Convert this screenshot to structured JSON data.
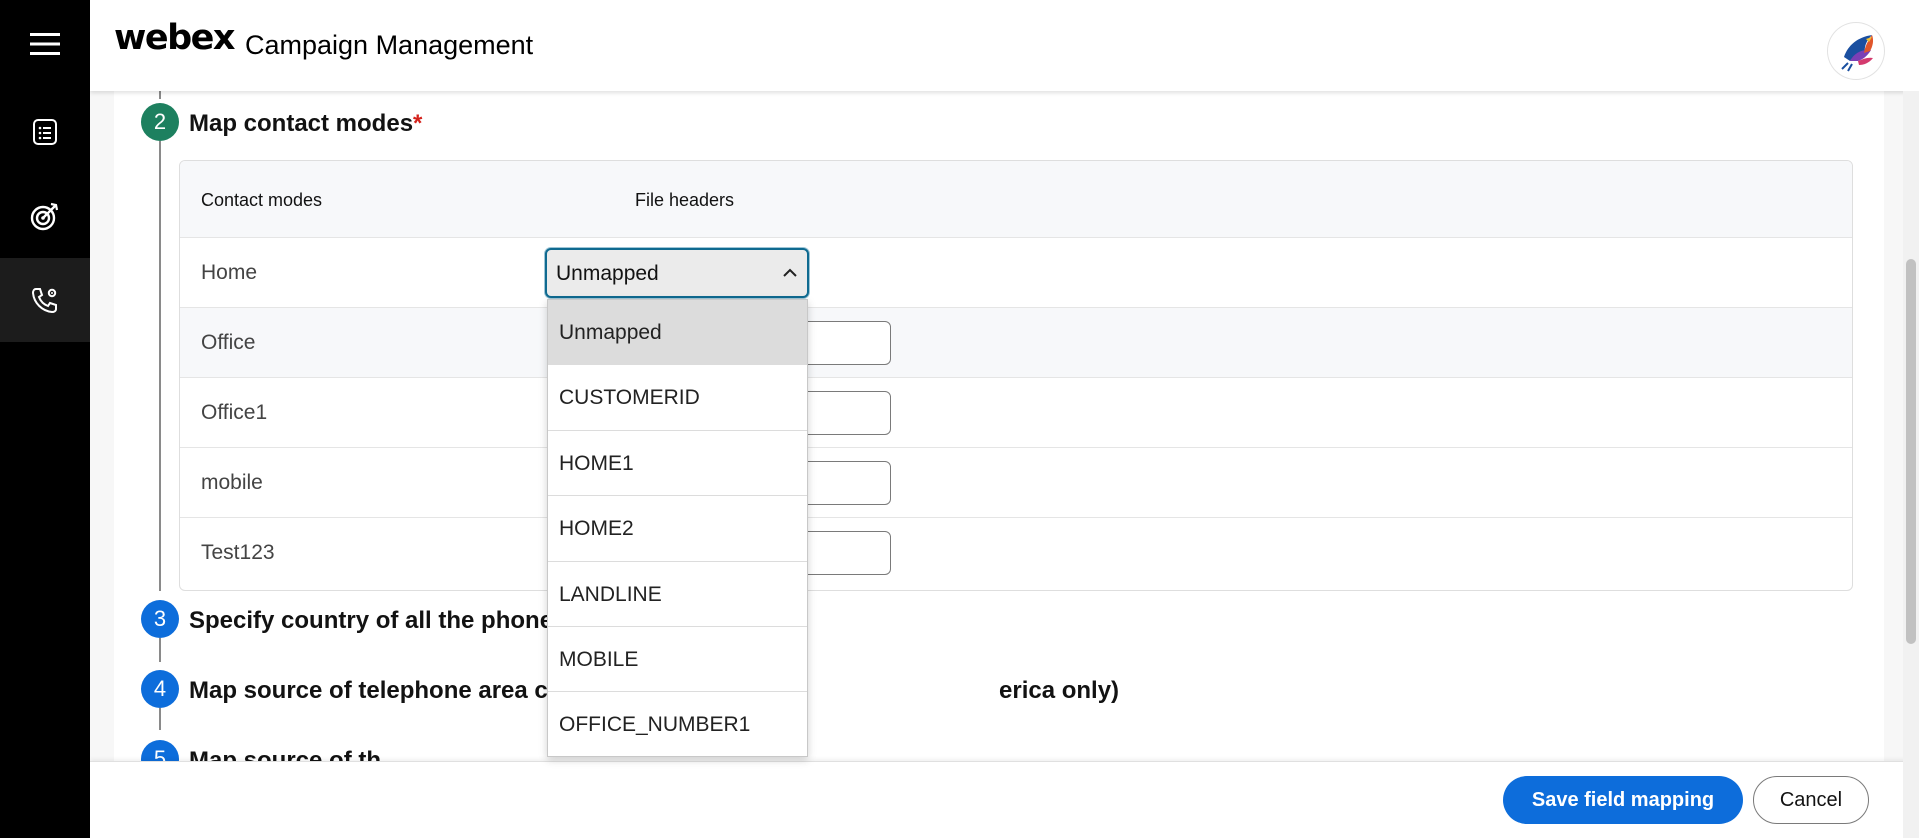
{
  "header": {
    "logo": "webex",
    "title": "Campaign Management"
  },
  "sidebar": {
    "items": [
      {
        "icon": "menu-icon"
      },
      {
        "icon": "list-icon"
      },
      {
        "icon": "target-icon"
      },
      {
        "icon": "phone-settings-icon"
      }
    ]
  },
  "steps": {
    "s2": {
      "number": "2",
      "title": "Map contact modes",
      "required_mark": "*"
    },
    "s3": {
      "number": "3",
      "title": "Specify country of all the phone numbe"
    },
    "s4": {
      "number": "4",
      "title_left": "Map source of telephone area codes (a",
      "title_right": "erica only)"
    },
    "s5": {
      "number": "5",
      "title": "Map source of th"
    }
  },
  "table": {
    "headers": {
      "mode": "Contact modes",
      "file": "File headers"
    },
    "rows": [
      {
        "label": "Home"
      },
      {
        "label": "Office"
      },
      {
        "label": "Office1"
      },
      {
        "label": "mobile"
      },
      {
        "label": "Test123"
      }
    ]
  },
  "select": {
    "value": "Unmapped",
    "options": [
      "Unmapped",
      "CUSTOMERID",
      "HOME1",
      "HOME2",
      "LANDLINE",
      "MOBILE",
      "OFFICE_NUMBER1"
    ]
  },
  "footer": {
    "save_label": "Save field mapping",
    "cancel_label": "Cancel"
  },
  "colors": {
    "accent": "#0d6ddb",
    "step_done": "#1d805f",
    "required": "#d4221c"
  }
}
